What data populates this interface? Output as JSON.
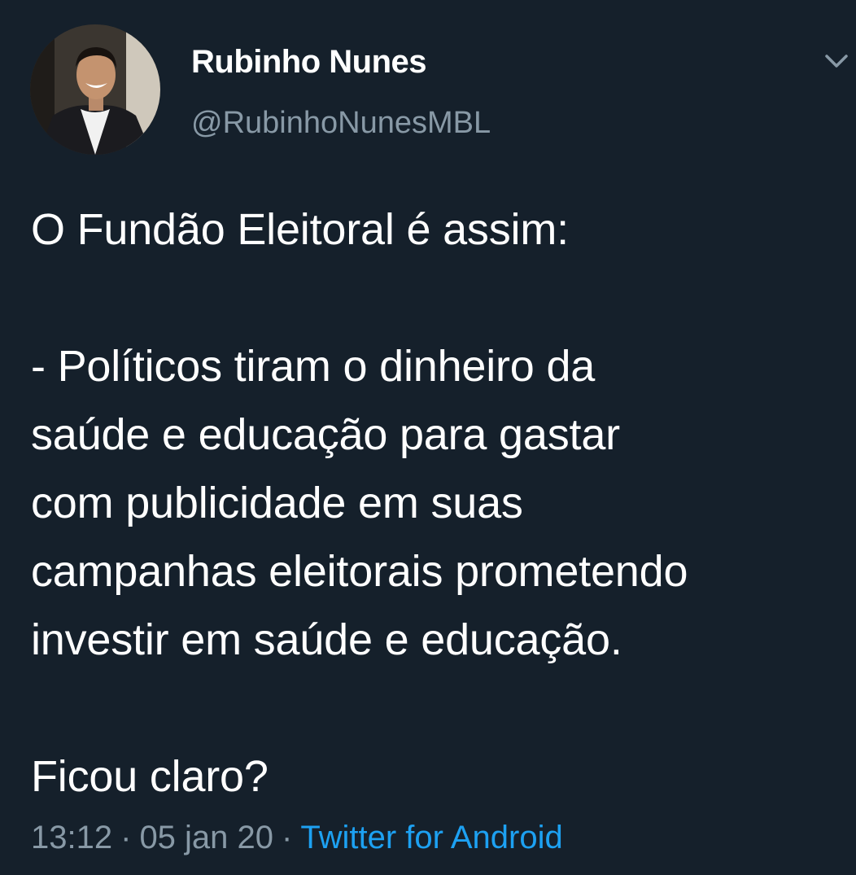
{
  "tweet": {
    "author": {
      "name": "Rubinho Nunes",
      "handle": "@RubinhoNunesMBL"
    },
    "text": "O Fundão Eleitoral é assim:\n\n- Políticos tiram o dinheiro da\nsaúde e educação para gastar\ncom publicidade em suas\ncampanhas eleitorais prometendo\ninvestir em saúde e educação.\n\nFicou claro?",
    "time": "13:12",
    "date": "05 jan 20",
    "separator": "·",
    "source": "Twitter for Android"
  },
  "icons": {
    "menu": "chevron-down-icon"
  },
  "colors": {
    "background": "#15202b",
    "text": "#ffffff",
    "secondary_text": "#8899a6",
    "link": "#1da1f2"
  }
}
